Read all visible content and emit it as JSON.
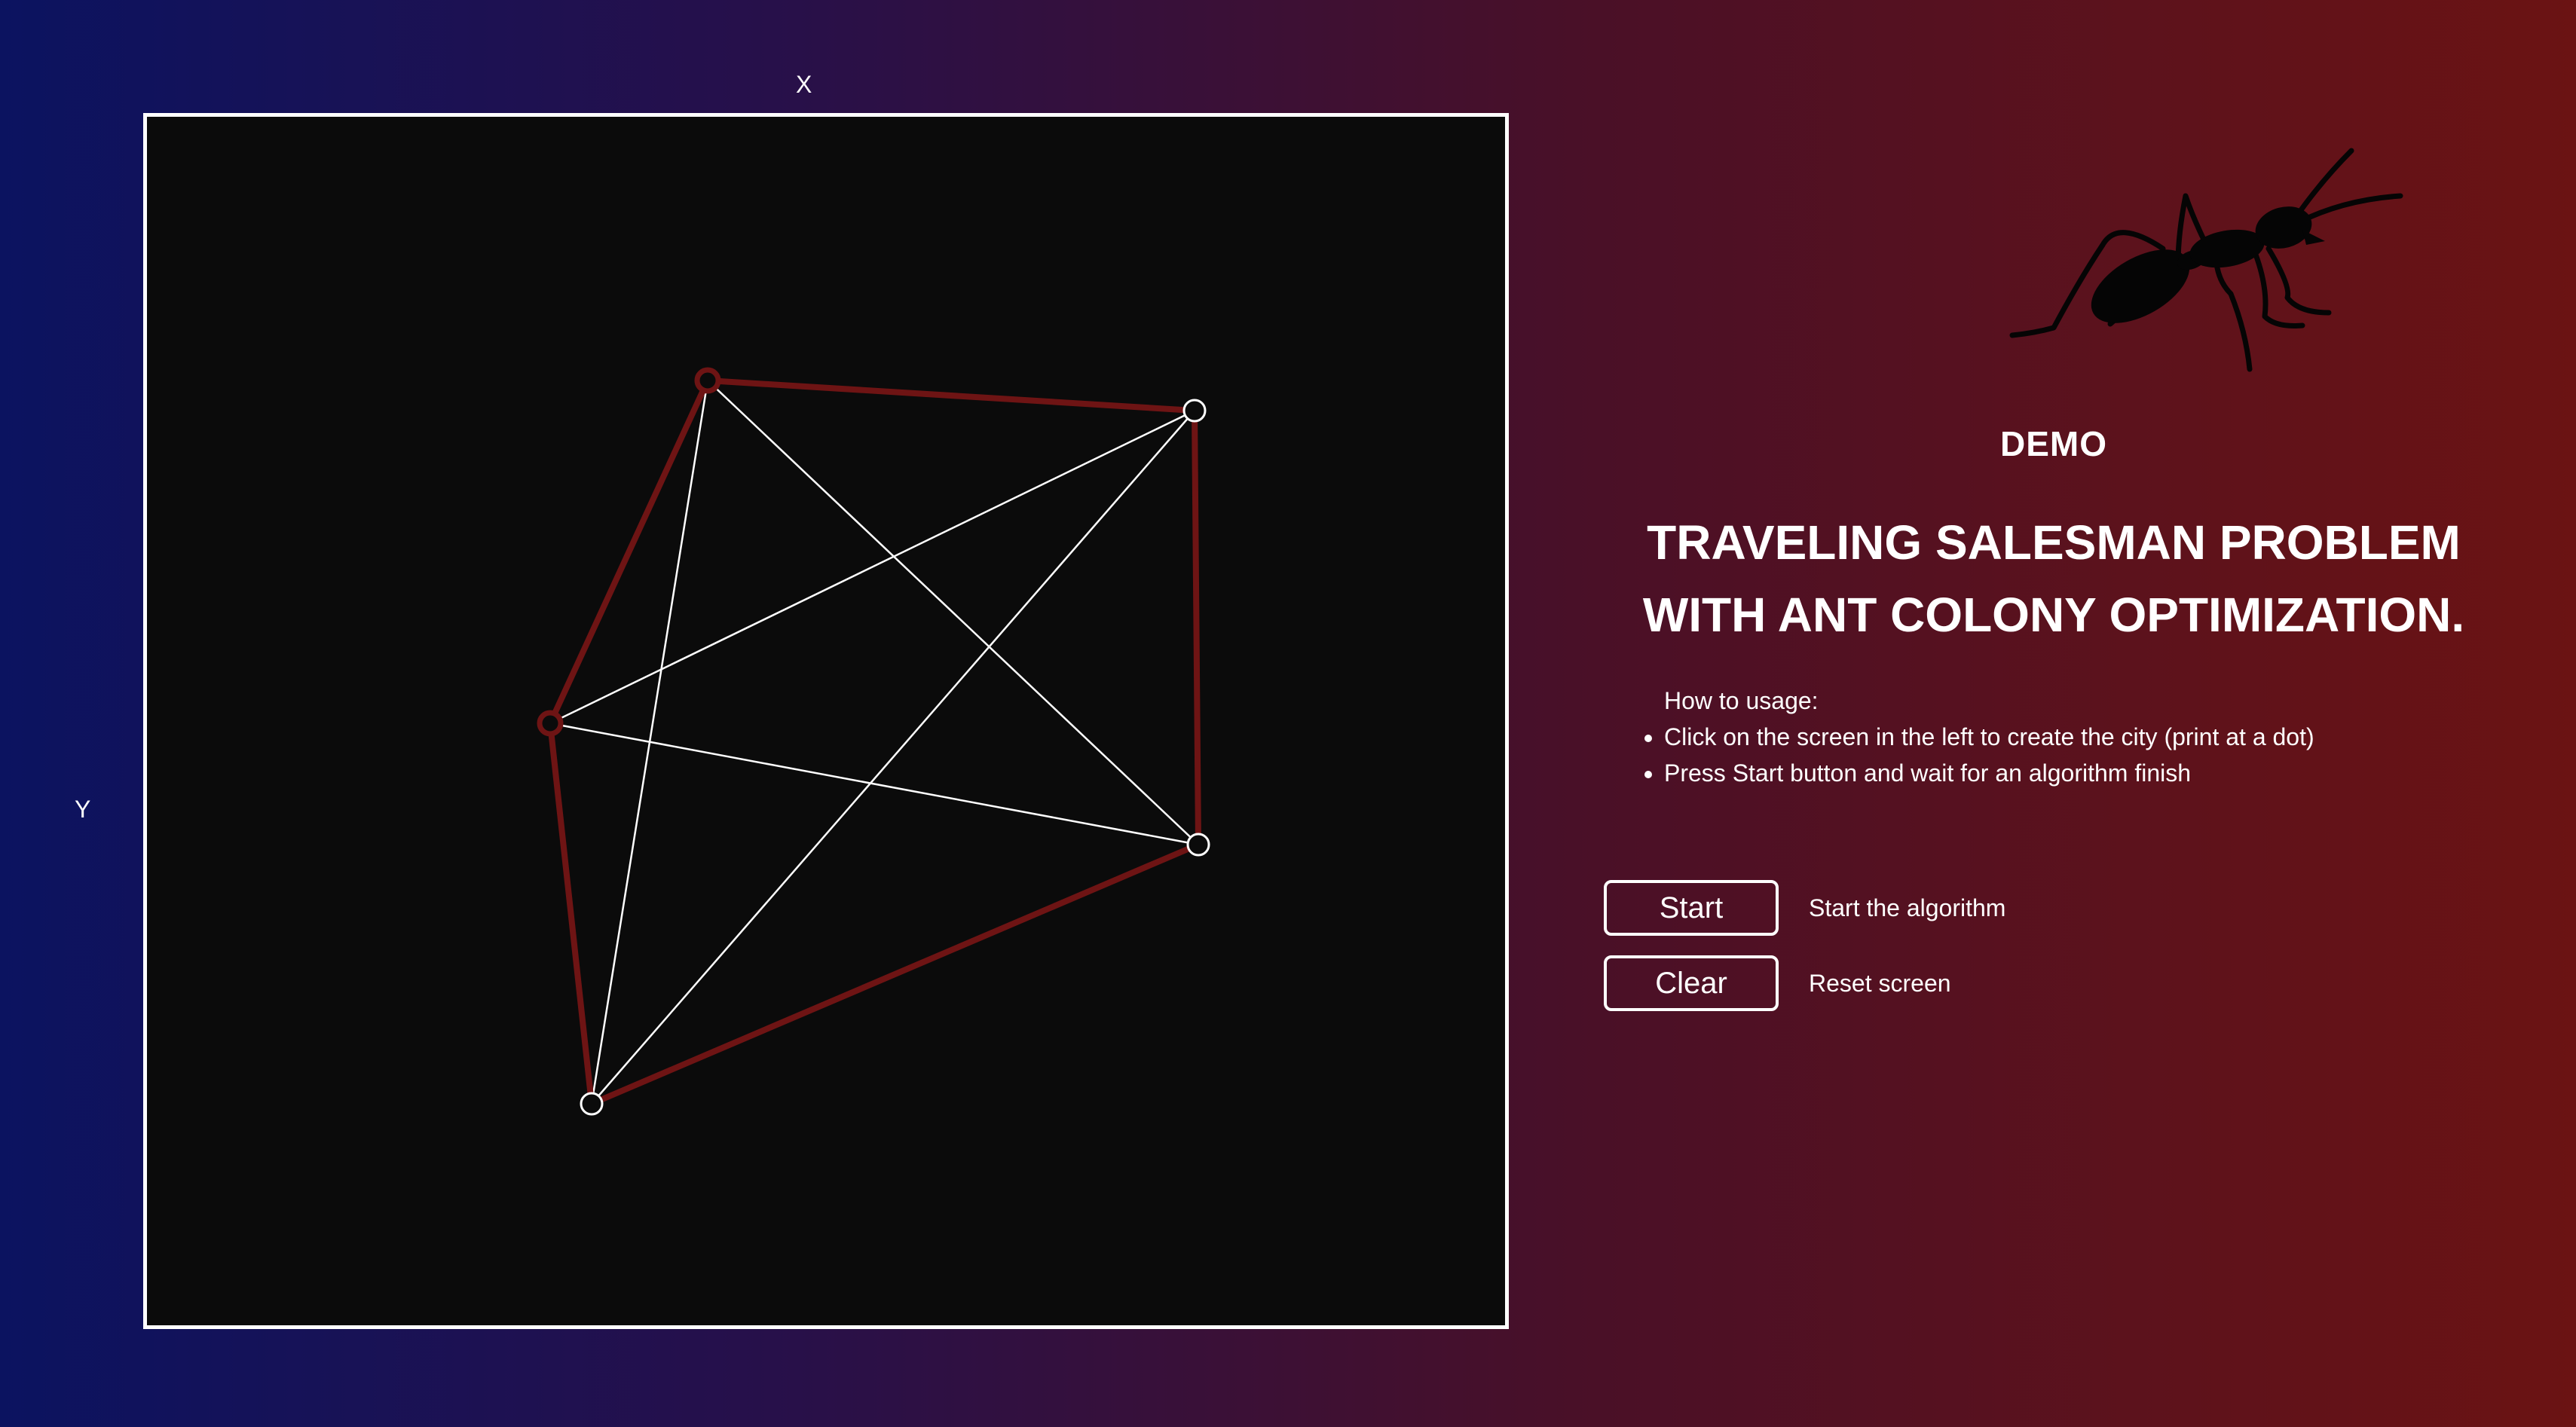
{
  "axes": {
    "x_label": "X",
    "y_label": "Y"
  },
  "canvas": {
    "background": "#0b0b0b",
    "border_color": "#ffffff",
    "edge_color": "#ffffff",
    "route_color": "#6e1414"
  },
  "panel": {
    "icon": "ant-icon",
    "demo_label": "DEMO",
    "title_line1": "TRAVELING SALESMAN PROBLEM",
    "title_line2": "WITH ANT COLONY OPTIMIZATION.",
    "howto_title": "How to usage:",
    "howto_items": [
      "Click on the screen in the left to create the city (print at a dot)",
      "Press Start button and wait for an algorithm finish"
    ]
  },
  "actions": {
    "start_label": "Start",
    "start_desc": "Start the algorithm",
    "clear_label": "Clear",
    "clear_desc": "Reset screen"
  },
  "colors": {
    "bg_left": "#0b1360",
    "bg_right": "#6b1313",
    "text": "#ffffff"
  }
}
